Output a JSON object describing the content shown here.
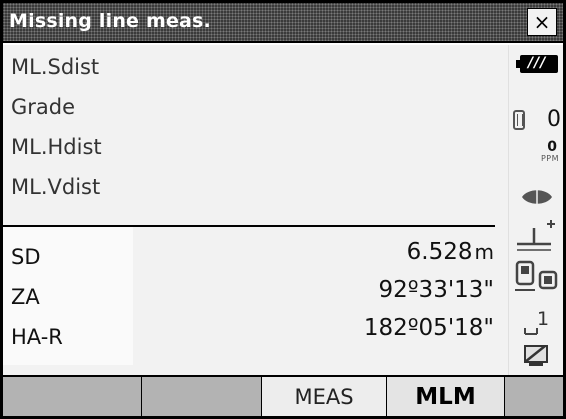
{
  "window": {
    "title": "Missing line meas.",
    "close_glyph": "×"
  },
  "results": {
    "labels": [
      "ML.Sdist",
      "Grade",
      "ML.Hdist",
      "ML.Vdist"
    ]
  },
  "observations": [
    {
      "label": "SD",
      "value": "6.528",
      "unit": "m"
    },
    {
      "label": "ZA",
      "value": "92º33'13\"",
      "unit": ""
    },
    {
      "label": "HA-R",
      "value": "182º05'18\"",
      "unit": ""
    }
  ],
  "status": {
    "battery_icon": "battery-icon",
    "battery_bars": "///",
    "prism_constant": "0",
    "ppm_value": "0",
    "ppm_label": "PPM",
    "input_mode_number": "1"
  },
  "softkeys": [
    "",
    "",
    "MEAS",
    "MLM",
    ""
  ],
  "softkey_active_index": 3,
  "colors": {
    "title_bg": "#3a3a3a",
    "softkey_bg": "#b3b3b3",
    "content_bg": "#f2f2f2"
  }
}
